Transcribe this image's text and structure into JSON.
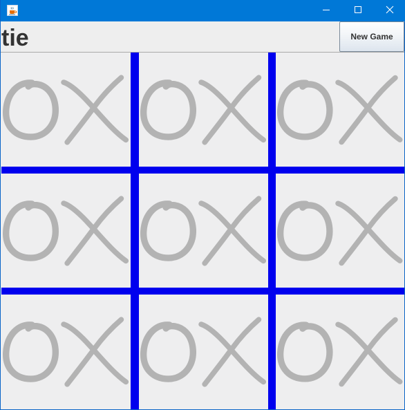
{
  "window": {
    "app_icon": "java-coffee-cup-icon",
    "controls": {
      "minimize_icon": "minimize-icon",
      "maximize_icon": "maximize-icon",
      "close_icon": "close-icon"
    },
    "titlebar_color": "#0078d7"
  },
  "status": {
    "text": "tie"
  },
  "toolbar": {
    "new_game_label": "New Game"
  },
  "board": {
    "grid_color": "#0000ee",
    "mark_color": "#b3b3b3",
    "cells": [
      [
        "O",
        "X",
        "O"
      ],
      [
        "O",
        "X",
        "X"
      ],
      [
        "X",
        "O",
        "X"
      ]
    ]
  }
}
